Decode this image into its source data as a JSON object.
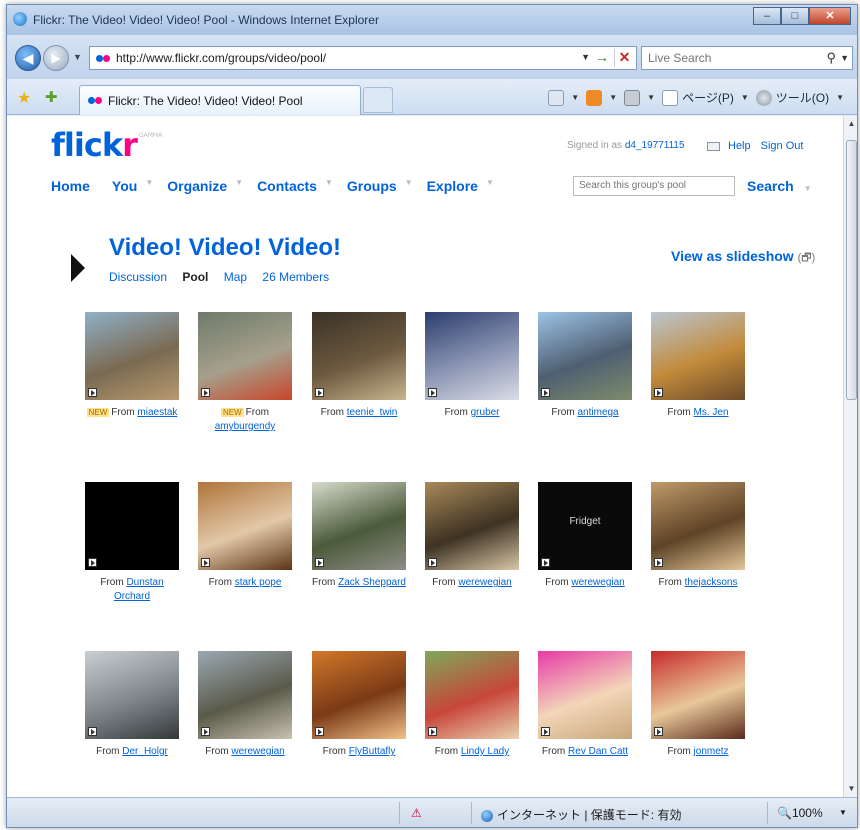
{
  "window": {
    "title": "Flickr: The Video! Video! Video! Pool - Windows Internet Explorer"
  },
  "address": {
    "url": "http://www.flickr.com/groups/video/pool/",
    "search_placeholder": "Live Search"
  },
  "tab": {
    "title": "Flickr: The Video! Video! Video! Pool"
  },
  "commands": {
    "page": "ページ(P)",
    "tools": "ツール(O)"
  },
  "header": {
    "logo_f": "flick",
    "logo_r": "r",
    "logo_beta": "GAMMA",
    "signed_in_prefix": "Signed in as ",
    "username": "d4_19771115",
    "help": "Help",
    "sign_out": "Sign Out"
  },
  "nav": {
    "home": "Home",
    "you": "You",
    "organize": "Organize",
    "contacts": "Contacts",
    "groups": "Groups",
    "explore": "Explore",
    "search_placeholder": "Search this group's pool",
    "search": "Search"
  },
  "group": {
    "title": "Video! Video! Video!",
    "discussion": "Discussion",
    "pool": "Pool",
    "map": "Map",
    "members": "26 Members",
    "slideshow": "View as slideshow",
    "slideshow_icon": "(🗗)"
  },
  "photos": [
    {
      "new": "NEW",
      "from": "From",
      "user": "miaestak",
      "colors": [
        "#8fb0c8",
        "#7a6a52",
        "#b89a6e"
      ]
    },
    {
      "new": "NEW",
      "from": "From",
      "user": "amyburgendy",
      "colors": [
        "#6e7a6a",
        "#a5a08c",
        "#c9452a"
      ]
    },
    {
      "new": "",
      "from": "From",
      "user": "teenie_twin",
      "colors": [
        "#3a3226",
        "#6d5a40",
        "#c7b58e"
      ]
    },
    {
      "new": "",
      "from": "From",
      "user": "gruber",
      "colors": [
        "#2c3e6e",
        "#8d96b4",
        "#d9dde6"
      ]
    },
    {
      "new": "",
      "from": "From",
      "user": "antimega",
      "colors": [
        "#9cc3e6",
        "#4f5f72",
        "#7d8c6a"
      ]
    },
    {
      "new": "",
      "from": "From",
      "user": "Ms. Jen",
      "colors": [
        "#b9c6d2",
        "#c28a3a",
        "#6b4a2a"
      ]
    },
    {
      "new": "",
      "from": "From",
      "user": "Dunstan Orchard",
      "colors": [
        "#000000",
        "#000000",
        "#000000"
      ]
    },
    {
      "new": "",
      "from": "From",
      "user": "stark pope",
      "colors": [
        "#b0743a",
        "#e2c8a8",
        "#5a3416"
      ]
    },
    {
      "new": "",
      "from": "From",
      "user": "Zack Sheppard",
      "colors": [
        "#d7dccc",
        "#4a5a3a",
        "#8e8e86"
      ]
    },
    {
      "new": "",
      "from": "From",
      "user": "werewegian",
      "colors": [
        "#a88a5a",
        "#3e3222",
        "#d8c8a8"
      ]
    },
    {
      "new": "",
      "from": "From",
      "user": "werewegian",
      "colors": [
        "#0a0a0a",
        "#0a0a0a",
        "#0a0a0a"
      ],
      "label": "Fridget"
    },
    {
      "new": "",
      "from": "From",
      "user": "thejacksons",
      "colors": [
        "#c09a6a",
        "#5e4326",
        "#e3c79a"
      ]
    },
    {
      "new": "",
      "from": "From",
      "user": "Der_Holgr",
      "colors": [
        "#c9ced2",
        "#7e858a",
        "#34383a"
      ]
    },
    {
      "new": "",
      "from": "From",
      "user": "werewegian",
      "colors": [
        "#9aa8b2",
        "#5a5a4a",
        "#c8c2b0"
      ]
    },
    {
      "new": "",
      "from": "From",
      "user": "FlyButtafly",
      "colors": [
        "#d2782a",
        "#7a3a16",
        "#f2c28a"
      ]
    },
    {
      "new": "",
      "from": "From",
      "user": "Lindy Lady",
      "colors": [
        "#7ea85a",
        "#c8463a",
        "#e8d2b0"
      ]
    },
    {
      "new": "",
      "from": "From",
      "user": "Rev Dan Catt",
      "colors": [
        "#e83aa6",
        "#f2d6b8",
        "#c8a67a"
      ]
    },
    {
      "new": "",
      "from": "From",
      "user": "jonmetz",
      "colors": [
        "#c82a2a",
        "#e8c89a",
        "#5a2a1a"
      ]
    }
  ],
  "status": {
    "zone": "インターネット | 保護モード: 有効",
    "zoom": "100%"
  },
  "colors": {
    "brand_blue": "#0063dc",
    "brand_pink": "#ff0084"
  }
}
